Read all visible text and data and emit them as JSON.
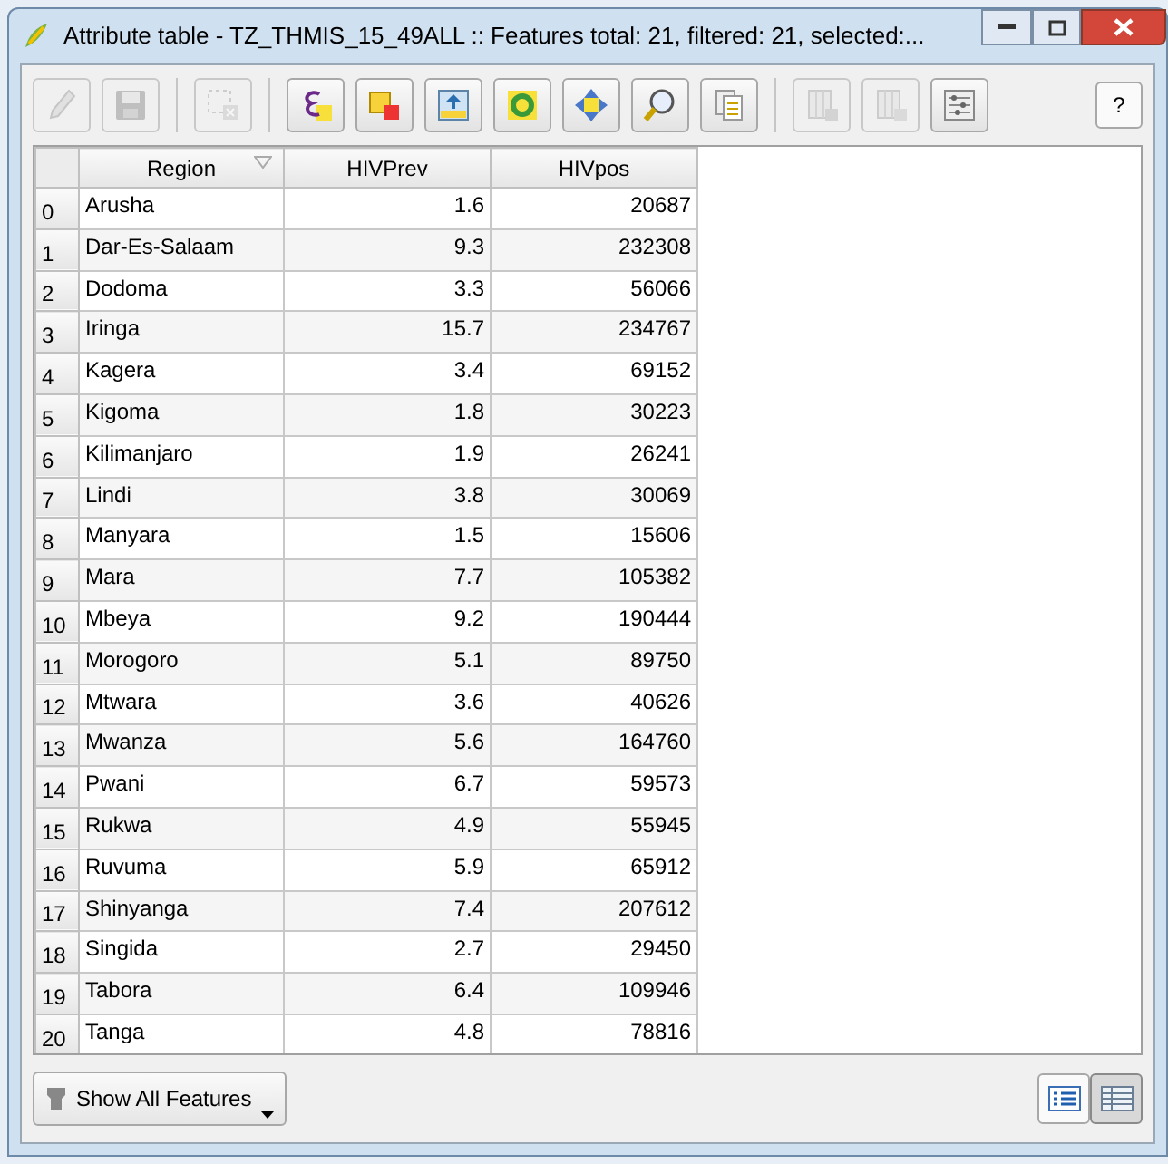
{
  "window": {
    "title": "Attribute table - TZ_THMIS_15_49ALL :: Features total: 21, filtered: 21, selected:..."
  },
  "toolbar": [
    {
      "kind": "pencil",
      "disabled": true
    },
    {
      "kind": "save",
      "disabled": true
    },
    {
      "kind": "sep"
    },
    {
      "kind": "deselect",
      "disabled": true
    },
    {
      "kind": "sep"
    },
    {
      "kind": "expression",
      "disabled": false
    },
    {
      "kind": "select",
      "disabled": false
    },
    {
      "kind": "movetop",
      "disabled": false
    },
    {
      "kind": "invert",
      "disabled": false
    },
    {
      "kind": "pan",
      "disabled": false
    },
    {
      "kind": "zoom",
      "disabled": false
    },
    {
      "kind": "copy",
      "disabled": false
    },
    {
      "kind": "sep"
    },
    {
      "kind": "delcol",
      "disabled": true
    },
    {
      "kind": "addcol",
      "disabled": true
    },
    {
      "kind": "calc",
      "disabled": false
    }
  ],
  "help_button": "?",
  "table": {
    "columns": [
      "Region",
      "HIVPrev",
      "HIVpos"
    ],
    "rows": [
      {
        "index": "0",
        "cells": [
          "Arusha",
          "1.6",
          "20687"
        ]
      },
      {
        "index": "1",
        "cells": [
          "Dar-Es-Salaam",
          "9.3",
          "232308"
        ]
      },
      {
        "index": "2",
        "cells": [
          "Dodoma",
          "3.3",
          "56066"
        ]
      },
      {
        "index": "3",
        "cells": [
          "Iringa",
          "15.7",
          "234767"
        ]
      },
      {
        "index": "4",
        "cells": [
          "Kagera",
          "3.4",
          "69152"
        ]
      },
      {
        "index": "5",
        "cells": [
          "Kigoma",
          "1.8",
          "30223"
        ]
      },
      {
        "index": "6",
        "cells": [
          "Kilimanjaro",
          "1.9",
          "26241"
        ]
      },
      {
        "index": "7",
        "cells": [
          "Lindi",
          "3.8",
          "30069"
        ]
      },
      {
        "index": "8",
        "cells": [
          "Manyara",
          "1.5",
          "15606"
        ]
      },
      {
        "index": "9",
        "cells": [
          "Mara",
          "7.7",
          "105382"
        ]
      },
      {
        "index": "10",
        "cells": [
          "Mbeya",
          "9.2",
          "190444"
        ]
      },
      {
        "index": "11",
        "cells": [
          "Morogoro",
          "5.1",
          "89750"
        ]
      },
      {
        "index": "12",
        "cells": [
          "Mtwara",
          "3.6",
          "40626"
        ]
      },
      {
        "index": "13",
        "cells": [
          "Mwanza",
          "5.6",
          "164760"
        ]
      },
      {
        "index": "14",
        "cells": [
          "Pwani",
          "6.7",
          "59573"
        ]
      },
      {
        "index": "15",
        "cells": [
          "Rukwa",
          "4.9",
          "55945"
        ]
      },
      {
        "index": "16",
        "cells": [
          "Ruvuma",
          "5.9",
          "65912"
        ]
      },
      {
        "index": "17",
        "cells": [
          "Shinyanga",
          "7.4",
          "207612"
        ]
      },
      {
        "index": "18",
        "cells": [
          "Singida",
          "2.7",
          "29450"
        ]
      },
      {
        "index": "19",
        "cells": [
          "Tabora",
          "6.4",
          "109946"
        ]
      },
      {
        "index": "20",
        "cells": [
          "Tanga",
          "4.8",
          "78816"
        ]
      }
    ]
  },
  "filter_button": {
    "label": "Show All Features"
  },
  "view_buttons": [
    {
      "kind": "form",
      "selected": false
    },
    {
      "kind": "table",
      "selected": true
    }
  ]
}
